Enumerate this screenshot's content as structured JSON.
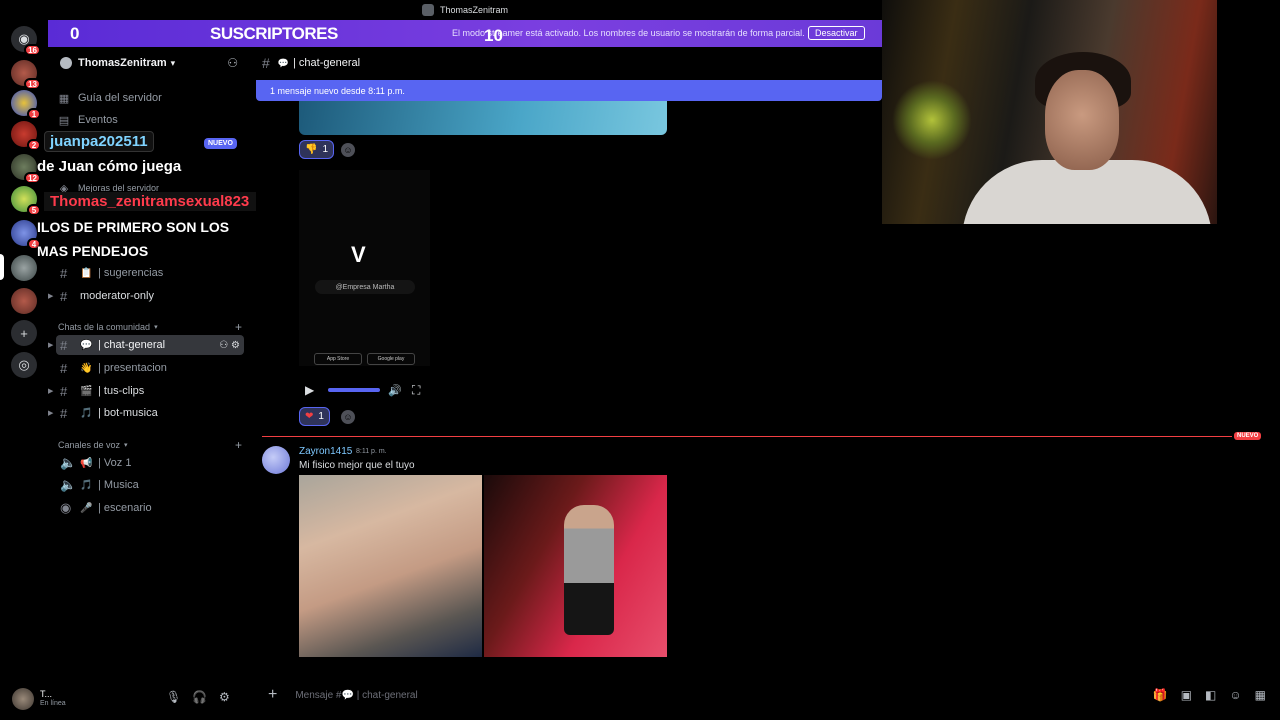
{
  "window": {
    "title": "ThomasZenitram"
  },
  "stream_overlay": {
    "subscriber_count": "0",
    "subscriber_label": "SUSCRIPTORES",
    "subscriber_goal": "10",
    "notice": "El modo streamer está activado. Los nombres de usuario se mostrarán de forma parcial.",
    "disable_button": "Desactivar",
    "chat_user_1": "juanpa202511",
    "chat_msg_1": "de Juan cómo juega",
    "chat_user_2": "Thomas_zenitramsexual823",
    "chat_msg_2_line1": "ILOS DE PRIMERO SON LOS",
    "chat_msg_2_line2": "MAS PENDEJOS",
    "new_badge": "NUEVO"
  },
  "server_rail": {
    "badges": [
      "16",
      "13",
      "1",
      "2",
      "12",
      "5",
      "4"
    ]
  },
  "server": {
    "name": "ThomasZenitram",
    "nav": [
      {
        "label": "Guía del servidor",
        "icon": "guide-icon"
      },
      {
        "label": "Eventos",
        "icon": "calendar-icon"
      },
      {
        "label": "Mejoras del servidor",
        "icon": "boost-icon"
      }
    ],
    "channels_top": [
      {
        "label": "| sugerencias",
        "emoji": "📋"
      },
      {
        "label": "moderator-only",
        "emoji": ""
      }
    ],
    "category_chat": "Chats de la comunidad",
    "chat_channels": [
      {
        "label": "| chat-general",
        "emoji": "💬",
        "active": true
      },
      {
        "label": "| presentacion",
        "emoji": "👋",
        "active": false
      },
      {
        "label": "| tus-clips",
        "emoji": "🎬",
        "active": false
      },
      {
        "label": "| bot-musica",
        "emoji": "🎵",
        "active": false
      }
    ],
    "category_voice": "Canales de voz",
    "voice_channels": [
      {
        "label": "| Voz 1",
        "emoji": "📢"
      },
      {
        "label": "| Musica",
        "emoji": "🎵"
      },
      {
        "label": "| escenario",
        "emoji": "🎤"
      }
    ]
  },
  "channel": {
    "name": "| chat-general",
    "new_messages_bar": "1 mensaje nuevo desde 8:11 p.m.",
    "reaction_1": {
      "emoji": "👎",
      "count": "1"
    },
    "video": {
      "logo": "V",
      "handle": "@Empresa Martha",
      "store_1": "App Store",
      "store_2": "Google play"
    },
    "reaction_2": {
      "emoji": "❤",
      "count": "1"
    },
    "divider_badge": "NUEVO",
    "message": {
      "author": "Zayron1415",
      "time": "8:11 p. m.",
      "text": "Mi fisico mejor que el tuyo"
    },
    "composer_placeholder": "Mensaje #💬 | chat-general"
  },
  "user_panel": {
    "name": "T...",
    "status": "En línea"
  }
}
